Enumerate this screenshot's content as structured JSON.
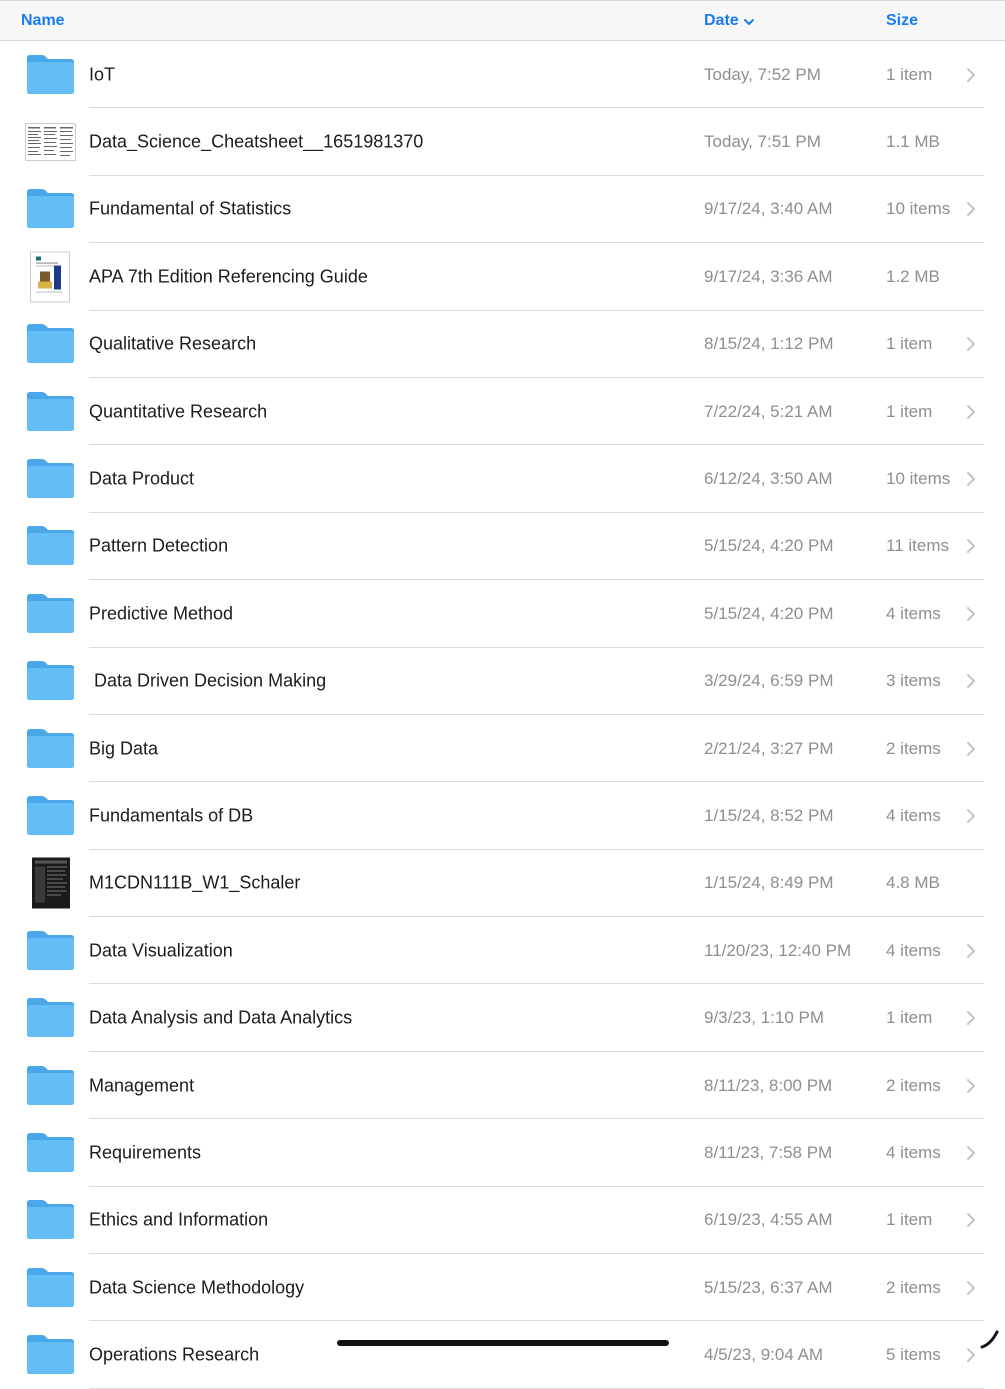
{
  "header": {
    "name_label": "Name",
    "date_label": "Date",
    "size_label": "Size",
    "sort_indicator_icon": "chevron-down-icon"
  },
  "colors": {
    "accent": "#1a7cf0",
    "folder": "#5ab8f0",
    "secondary_text": "#8e8e93"
  },
  "rows": [
    {
      "kind": "folder",
      "name": "IoT",
      "date": "Today, 7:52 PM",
      "size": "1 item"
    },
    {
      "kind": "sheet",
      "name": "Data_Science_Cheatsheet__1651981370",
      "date": "Today, 7:51 PM",
      "size": "1.1 MB"
    },
    {
      "kind": "folder",
      "name": "Fundamental of Statistics",
      "date": "9/17/24, 3:40 AM",
      "size": "10 items"
    },
    {
      "kind": "doc",
      "name": "APA 7th Edition Referencing Guide",
      "date": "9/17/24, 3:36 AM",
      "size": "1.2 MB"
    },
    {
      "kind": "folder",
      "name": "Qualitative Research",
      "date": "8/15/24, 1:12 PM",
      "size": "1 item"
    },
    {
      "kind": "folder",
      "name": "Quantitative Research",
      "date": "7/22/24, 5:21 AM",
      "size": "1 item"
    },
    {
      "kind": "folder",
      "name": "Data Product",
      "date": "6/12/24, 3:50 AM",
      "size": "10 items"
    },
    {
      "kind": "folder",
      "name": "Pattern Detection",
      "date": "5/15/24, 4:20 PM",
      "size": "11 items"
    },
    {
      "kind": "folder",
      "name": "Predictive Method",
      "date": "5/15/24, 4:20 PM",
      "size": "4 items"
    },
    {
      "kind": "folder",
      "name": " Data Driven Decision Making",
      "date": "3/29/24, 6:59 PM",
      "size": "3 items"
    },
    {
      "kind": "folder",
      "name": "Big Data",
      "date": "2/21/24, 3:27 PM",
      "size": "2 items"
    },
    {
      "kind": "folder",
      "name": "Fundamentals of DB",
      "date": "1/15/24, 8:52 PM",
      "size": "4 items"
    },
    {
      "kind": "dark",
      "name": "M1CDN111B_W1_Schaler",
      "date": "1/15/24, 8:49 PM",
      "size": "4.8 MB"
    },
    {
      "kind": "folder",
      "name": "Data Visualization",
      "date": "11/20/23, 12:40 PM",
      "size": "4 items"
    },
    {
      "kind": "folder",
      "name": "Data Analysis and Data Analytics",
      "date": "9/3/23, 1:10 PM",
      "size": "1 item"
    },
    {
      "kind": "folder",
      "name": "Management",
      "date": "8/11/23, 8:00 PM",
      "size": "2 items"
    },
    {
      "kind": "folder",
      "name": "Requirements",
      "date": "8/11/23, 7:58 PM",
      "size": "4 items"
    },
    {
      "kind": "folder",
      "name": "Ethics and Information",
      "date": "6/19/23, 4:55 AM",
      "size": "1 item"
    },
    {
      "kind": "folder",
      "name": "Data Science Methodology",
      "date": "5/15/23, 6:37 AM",
      "size": "2 items"
    },
    {
      "kind": "folder",
      "name": "Operations Research",
      "date": "4/5/23, 9:04 AM",
      "size": "5 items"
    }
  ]
}
